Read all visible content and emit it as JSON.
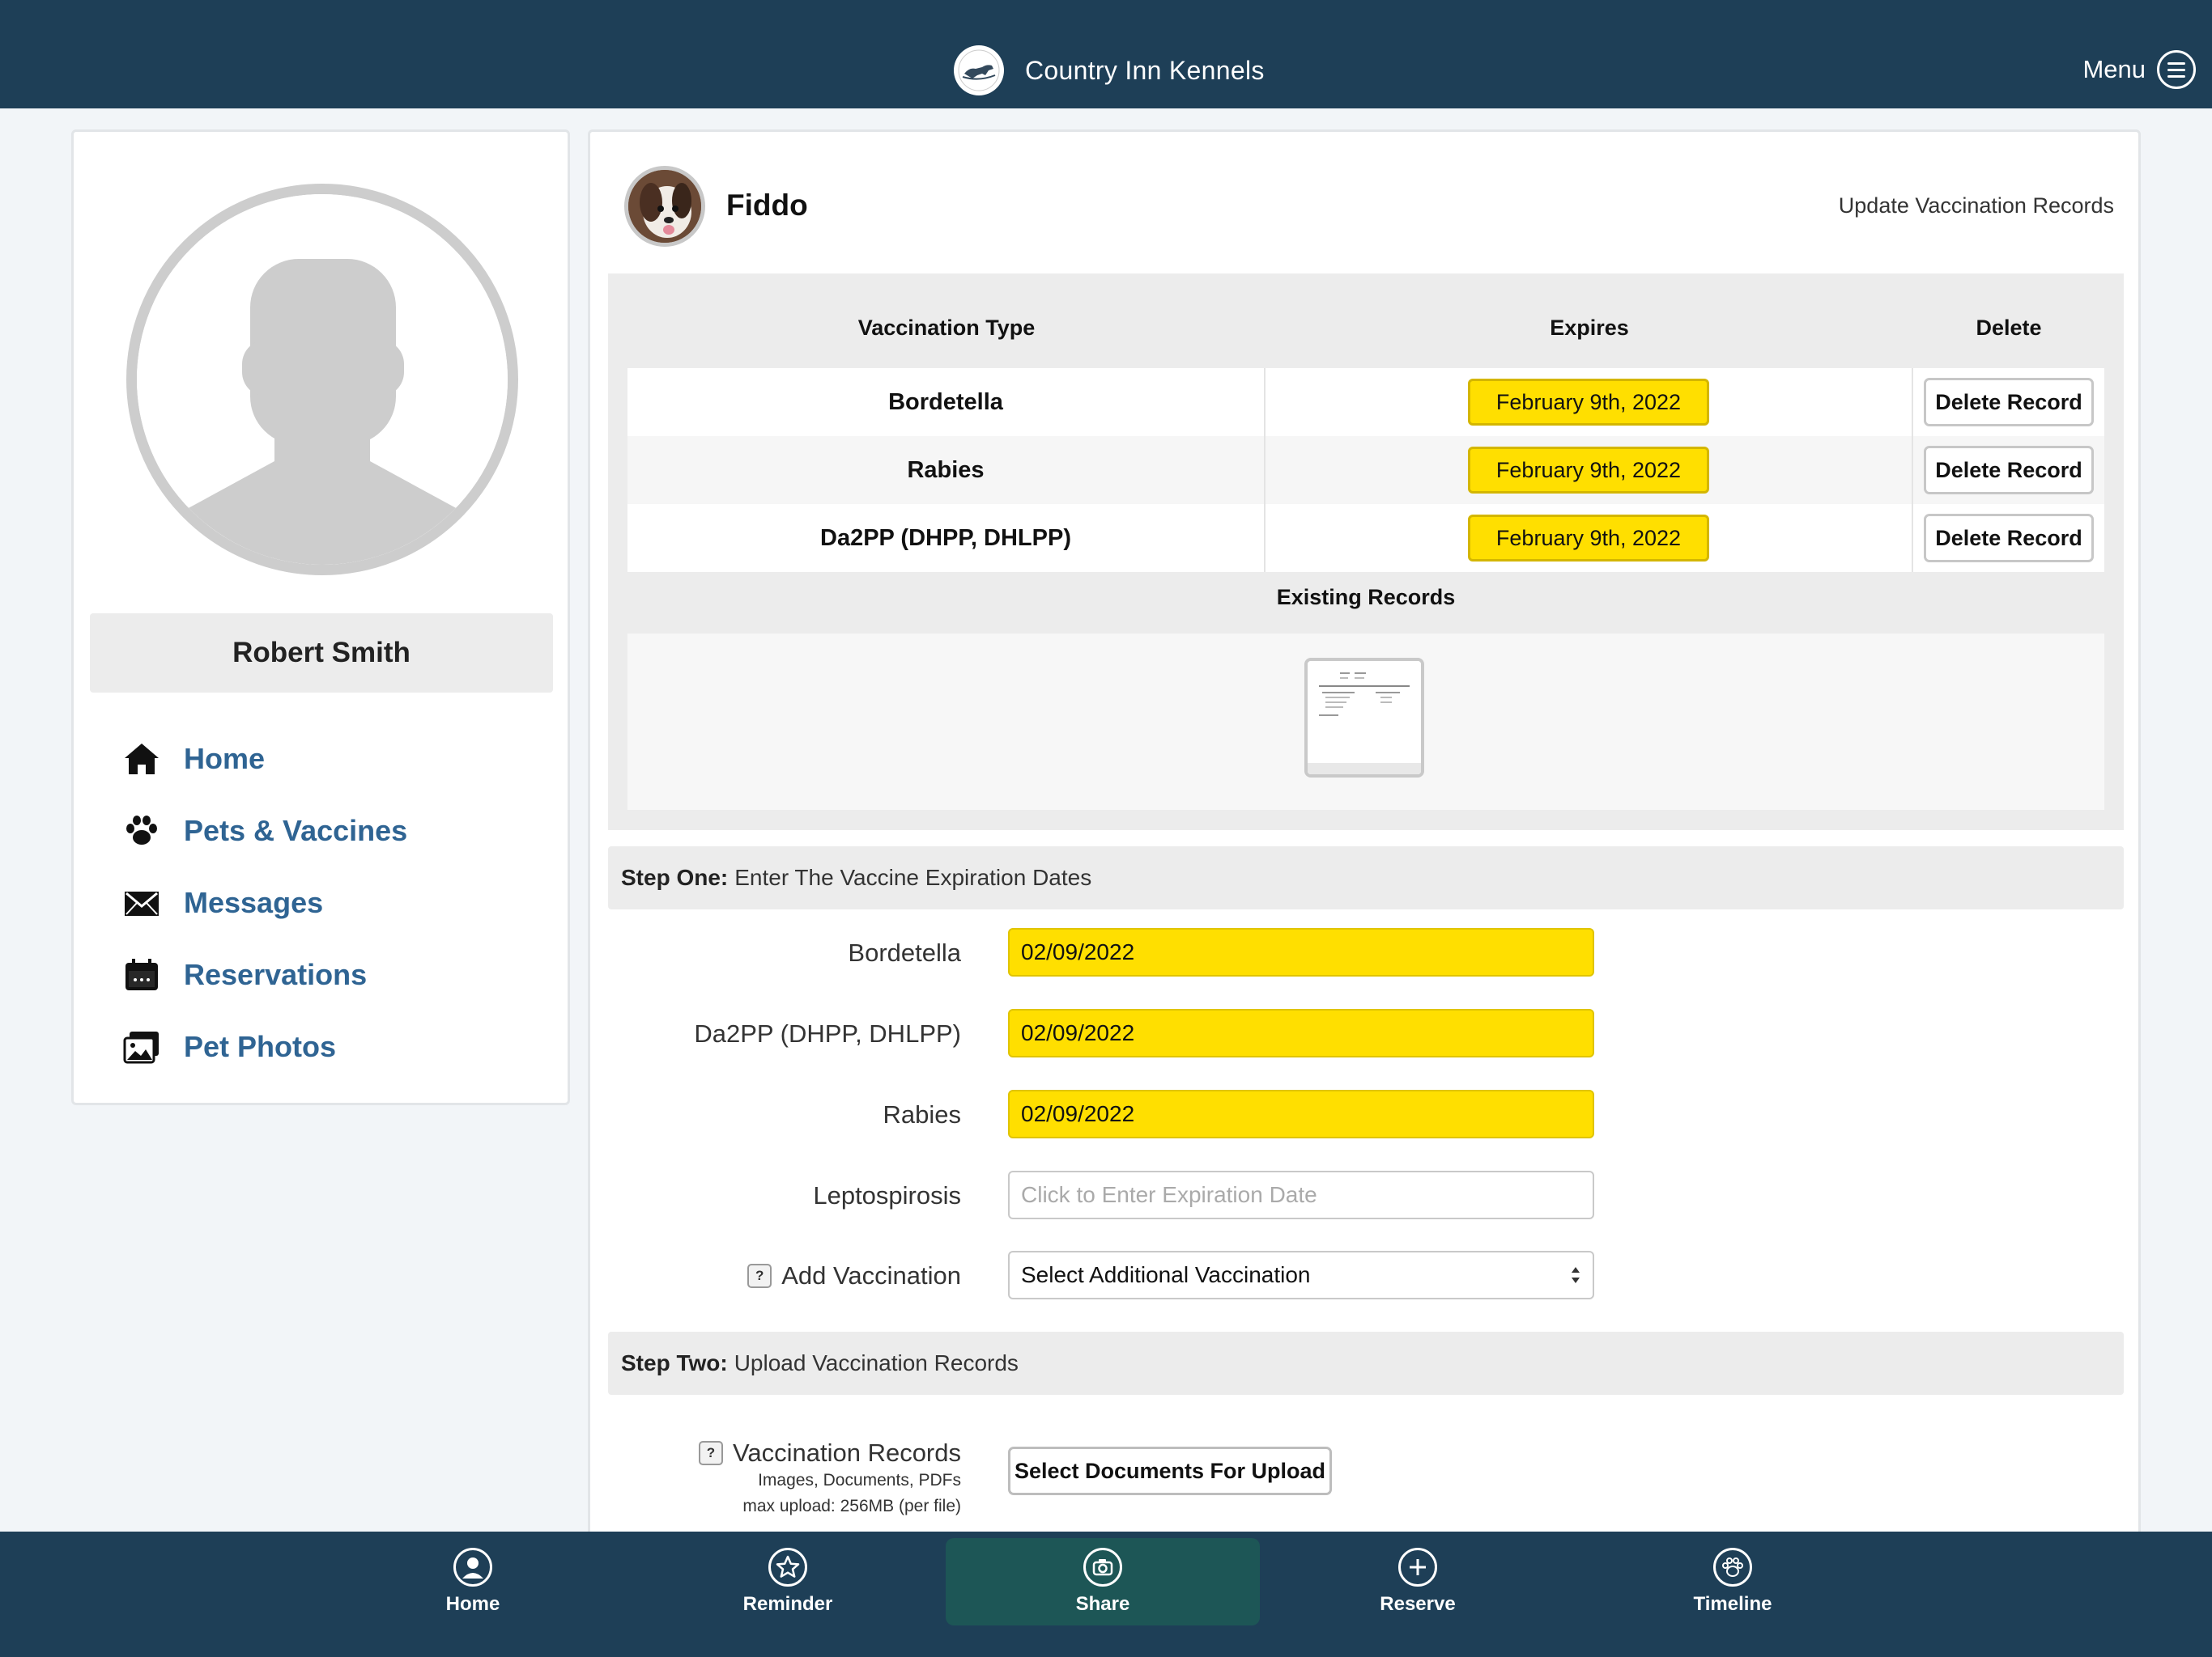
{
  "app": {
    "title": "Country Inn Kennels",
    "menu_label": "Menu"
  },
  "sidebar": {
    "user_name": "Robert Smith",
    "nav": [
      {
        "label": "Home",
        "icon": "house-icon"
      },
      {
        "label": "Pets & Vaccines",
        "icon": "paw-icon"
      },
      {
        "label": "Messages",
        "icon": "envelope-icon"
      },
      {
        "label": "Reservations",
        "icon": "calendar-icon"
      },
      {
        "label": "Pet Photos",
        "icon": "photos-icon"
      }
    ]
  },
  "pet": {
    "name": "Fiddo",
    "update_link": "Update Vaccination Records"
  },
  "records_table": {
    "headers": {
      "type": "Vaccination Type",
      "expires": "Expires",
      "delete": "Delete"
    },
    "rows": [
      {
        "type": "Bordetella",
        "expires": "February 9th, 2022",
        "action": "Delete Record"
      },
      {
        "type": "Rabies",
        "expires": "February 9th, 2022",
        "action": "Delete Record"
      },
      {
        "type": "Da2PP (DHPP, DHLPP)",
        "expires": "February 9th, 2022",
        "action": "Delete Record"
      }
    ],
    "existing_title": "Existing Records"
  },
  "step_one": {
    "bold": "Step One:",
    "text": "Enter The Vaccine Expiration Dates",
    "fields": [
      {
        "label": "Bordetella",
        "value": "02/09/2022"
      },
      {
        "label": "Da2PP (DHPP, DHLPP)",
        "value": "02/09/2022"
      },
      {
        "label": "Rabies",
        "value": "02/09/2022"
      },
      {
        "label": "Leptospirosis",
        "value": "",
        "placeholder": "Click to Enter Expiration Date"
      }
    ],
    "add_label": "Add Vaccination",
    "add_select": "Select Additional Vaccination"
  },
  "step_two": {
    "bold": "Step Two:",
    "text": "Upload Vaccination Records",
    "label": "Vaccination Records",
    "note_line1": "Images, Documents, PDFs",
    "note_line2": "max upload: 256MB (per file)",
    "button": "Select Documents For Upload"
  },
  "bottom_tabs": [
    {
      "label": "Home",
      "icon": "person-circle-icon"
    },
    {
      "label": "Reminder",
      "icon": "star-icon"
    },
    {
      "label": "Share",
      "icon": "camera-icon",
      "active": true
    },
    {
      "label": "Reserve",
      "icon": "plus-circle-icon"
    },
    {
      "label": "Timeline",
      "icon": "paw-circle-icon"
    }
  ],
  "colors": {
    "navy": "#1e3f57",
    "highlight_yellow": "#ffdf00",
    "link_blue": "#2f6493",
    "active_tab": "#1d5656"
  }
}
